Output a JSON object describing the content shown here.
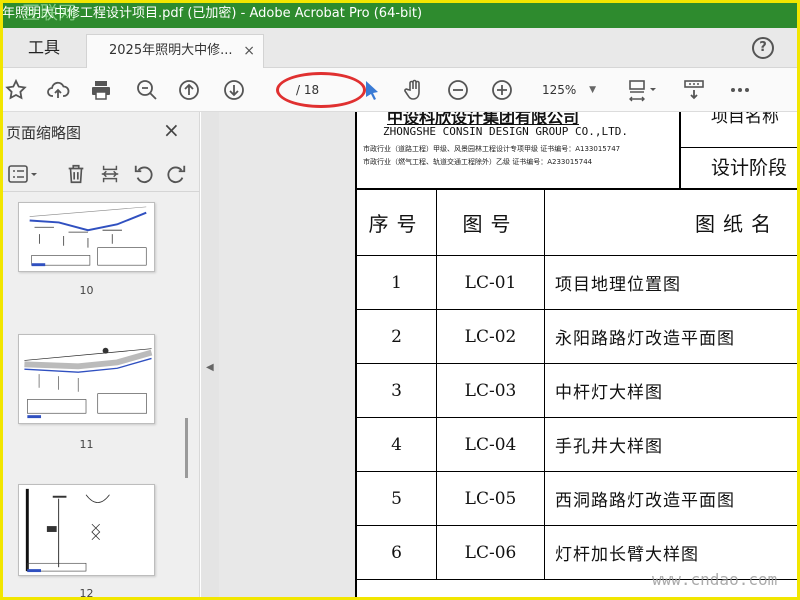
{
  "window": {
    "title": "年照明大中修工程设计项目.pdf  (已加密)  - Adobe Acrobat Pro (64-bit)",
    "watermark": "互联网",
    "title_bar_color": "#2e8b2e",
    "frame_color": "#f2e600"
  },
  "tabs": {
    "tools_label": "工具",
    "doc_tab_label": "2025年照明大中修...",
    "doc_tab_close": "×",
    "help_label": "?"
  },
  "toolbar": {
    "icons": [
      "star-icon",
      "cloud-upload-icon",
      "print-icon",
      "zoom-out-magnifier-icon",
      "page-up-icon",
      "page-down-icon",
      "select-cursor-icon",
      "hand-icon",
      "zoom-minus-icon",
      "zoom-plus-icon",
      "fit-page-icon",
      "scroll-mode-icon",
      "more-icon"
    ],
    "page_total": "/ 18",
    "zoom_value": "125%",
    "highlight_color": "#e03030"
  },
  "sidebar": {
    "title": "页面缩略图",
    "close_label": "×",
    "thumbnails": [
      {
        "label": "10"
      },
      {
        "label": "11"
      },
      {
        "label": "12"
      }
    ]
  },
  "document": {
    "company_cn": "中设科欣设计集团有限公司",
    "company_en": "ZHONGSHE CONSIN DESIGN GROUP CO.,LTD.",
    "cert_line1": "市政行业（道路工程）甲级、风景园林工程设计专项甲级  证书编号：A133015747",
    "cert_line2": "市政行业（燃气工程、轨道交通工程除外）乙级  证书编号：A233015744",
    "project_name_label": "项目名称",
    "design_stage_label": "设计阶段",
    "table_headers": [
      "序号",
      "图号",
      "图纸名"
    ],
    "rows": [
      {
        "no": "1",
        "code": "LC-01",
        "name": "项目地理位置图"
      },
      {
        "no": "2",
        "code": "LC-02",
        "name": "永阳路路灯改造平面图"
      },
      {
        "no": "3",
        "code": "LC-03",
        "name": "中杆灯大样图"
      },
      {
        "no": "4",
        "code": "LC-04",
        "name": "手孔井大样图"
      },
      {
        "no": "5",
        "code": "LC-05",
        "name": "西洞路路灯改造平面图"
      },
      {
        "no": "6",
        "code": "LC-06",
        "name": "灯杆加长臂大样图"
      }
    ]
  },
  "footer_watermark": "www.cndao.com"
}
